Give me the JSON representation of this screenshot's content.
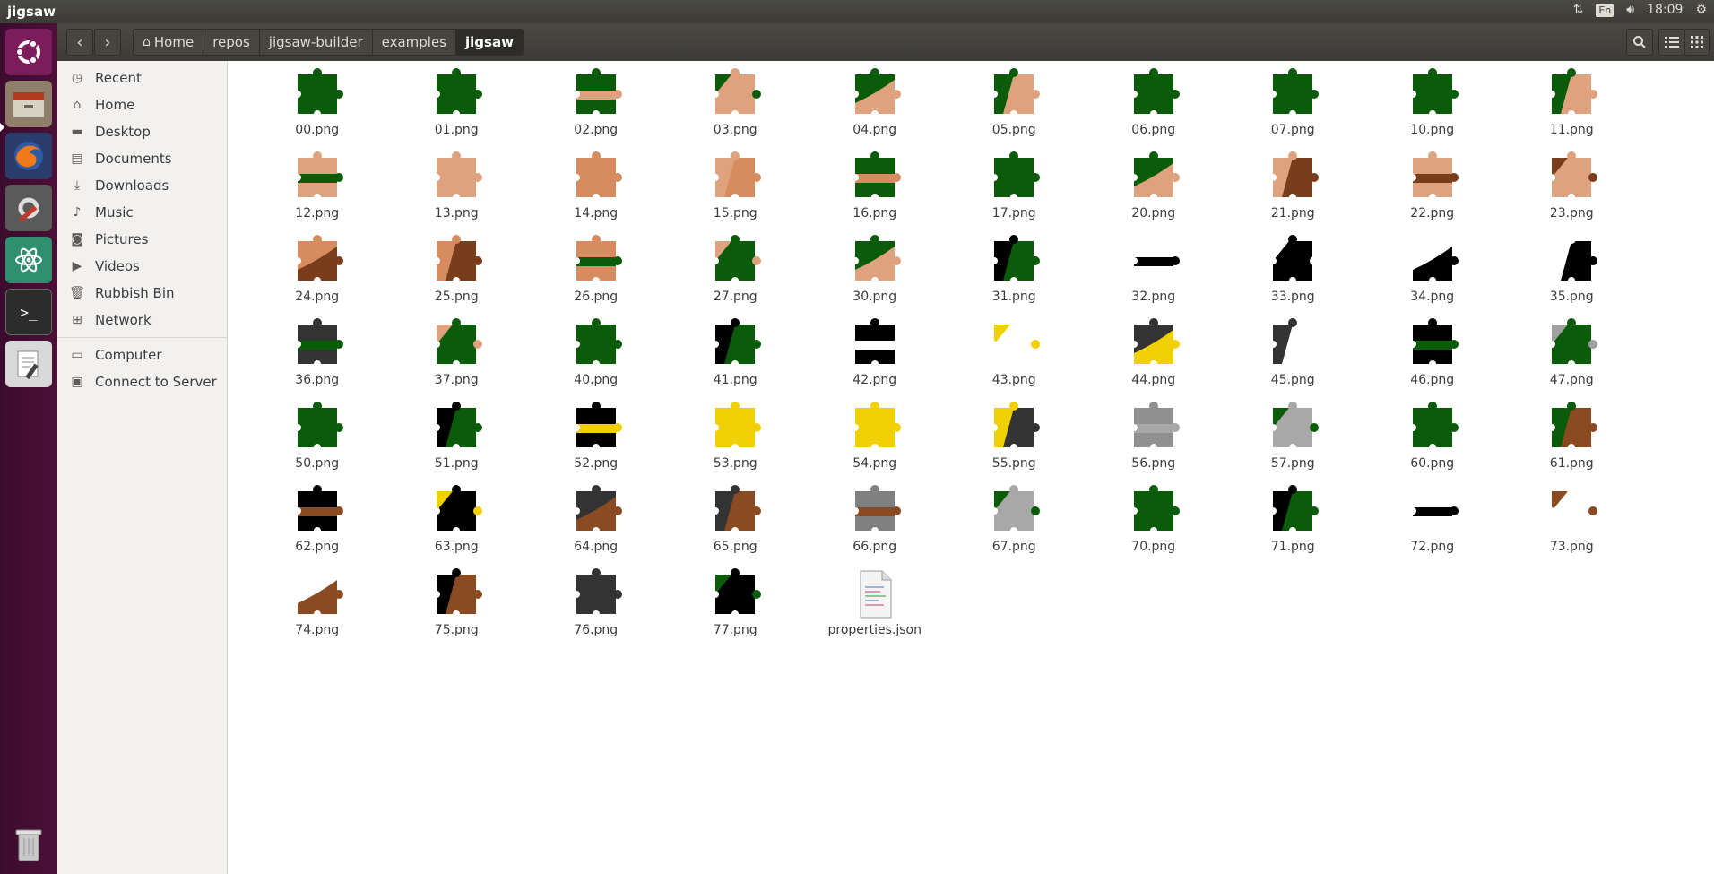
{
  "window": {
    "title": "jigsaw"
  },
  "topbar": {
    "clock": "18:09",
    "lang": "En",
    "icons": [
      "network-arrows-icon",
      "keyboard-lang-icon",
      "volume-icon",
      "gear-icon"
    ]
  },
  "launcher": {
    "items": [
      "ubuntu-dash-icon",
      "files-icon",
      "firefox-icon",
      "system-settings-icon",
      "atom-icon",
      "terminal-icon",
      "text-editor-icon",
      "trash-icon"
    ]
  },
  "header": {
    "crumbs": [
      "Home",
      "repos",
      "jigsaw-builder",
      "examples",
      "jigsaw"
    ]
  },
  "sidebar": {
    "places": [
      "Recent",
      "Home",
      "Desktop",
      "Documents",
      "Downloads",
      "Music",
      "Pictures",
      "Videos",
      "Rubbish Bin",
      "Network"
    ],
    "other": [
      "Computer",
      "Connect to Server"
    ]
  },
  "files": [
    {
      "name": "00.png",
      "c1": "#0a5c0a",
      "c2": "#0a5c0a"
    },
    {
      "name": "01.png",
      "c1": "#0a5c0a",
      "c2": "#0a5c0a"
    },
    {
      "name": "02.png",
      "c1": "#0a5c0a",
      "c2": "#dea27e"
    },
    {
      "name": "03.png",
      "c1": "#dea27e",
      "c2": "#0a5c0a"
    },
    {
      "name": "04.png",
      "c1": "#0a5c0a",
      "c2": "#dea27e"
    },
    {
      "name": "05.png",
      "c1": "#0a5c0a",
      "c2": "#dea27e"
    },
    {
      "name": "06.png",
      "c1": "#0a5c0a",
      "c2": "#0a5c0a"
    },
    {
      "name": "07.png",
      "c1": "#0a5c0a",
      "c2": "#0a5c0a"
    },
    {
      "name": "10.png",
      "c1": "#0a5c0a",
      "c2": "#0a5c0a"
    },
    {
      "name": "11.png",
      "c1": "#0a5c0a",
      "c2": "#dea27e"
    },
    {
      "name": "12.png",
      "c1": "#dea27e",
      "c2": "#0a5c0a"
    },
    {
      "name": "13.png",
      "c1": "#dea27e",
      "c2": "#dea27e"
    },
    {
      "name": "14.png",
      "c1": "#d68c5e",
      "c2": "#d68c5e"
    },
    {
      "name": "15.png",
      "c1": "#dea27e",
      "c2": "#d68c5e"
    },
    {
      "name": "16.png",
      "c1": "#0a5c0a",
      "c2": "#d68c5e"
    },
    {
      "name": "17.png",
      "c1": "#0a5c0a",
      "c2": "#0a5c0a"
    },
    {
      "name": "20.png",
      "c1": "#0a5c0a",
      "c2": "#dea27e"
    },
    {
      "name": "21.png",
      "c1": "#dea27e",
      "c2": "#7a3d1c"
    },
    {
      "name": "22.png",
      "c1": "#dea27e",
      "c2": "#7a3d1c"
    },
    {
      "name": "23.png",
      "c1": "#dea27e",
      "c2": "#7a3d1c"
    },
    {
      "name": "24.png",
      "c1": "#d68c5e",
      "c2": "#7a3d1c"
    },
    {
      "name": "25.png",
      "c1": "#d68c5e",
      "c2": "#7a3d1c"
    },
    {
      "name": "26.png",
      "c1": "#d68c5e",
      "c2": "#0a5c0a"
    },
    {
      "name": "27.png",
      "c1": "#0a5c0a",
      "c2": "#dea27e"
    },
    {
      "name": "30.png",
      "c1": "#0a5c0a",
      "c2": "#dea27e"
    },
    {
      "name": "31.png",
      "c1": "#000000",
      "c2": "#0a5c0a"
    },
    {
      "name": "32.png",
      "c1": "#ffffff",
      "c2": "#000000"
    },
    {
      "name": "33.png",
      "c1": "#000000",
      "c2": "#ffffff"
    },
    {
      "name": "34.png",
      "c1": "#ffffff",
      "c2": "#000000"
    },
    {
      "name": "35.png",
      "c1": "#ffffff",
      "c2": "#000000"
    },
    {
      "name": "36.png",
      "c1": "#333333",
      "c2": "#0a5c0a"
    },
    {
      "name": "37.png",
      "c1": "#0a5c0a",
      "c2": "#dea27e"
    },
    {
      "name": "40.png",
      "c1": "#0a5c0a",
      "c2": "#0a5c0a"
    },
    {
      "name": "41.png",
      "c1": "#000000",
      "c2": "#0a5c0a"
    },
    {
      "name": "42.png",
      "c1": "#000000",
      "c2": "#ffffff"
    },
    {
      "name": "43.png",
      "c1": "#ffffff",
      "c2": "#f0d000"
    },
    {
      "name": "44.png",
      "c1": "#333333",
      "c2": "#f0d000"
    },
    {
      "name": "45.png",
      "c1": "#333333",
      "c2": "#ffffff"
    },
    {
      "name": "46.png",
      "c1": "#000000",
      "c2": "#0a5c0a"
    },
    {
      "name": "47.png",
      "c1": "#0a5c0a",
      "c2": "#a0a0a0"
    },
    {
      "name": "50.png",
      "c1": "#0a5c0a",
      "c2": "#0a5c0a"
    },
    {
      "name": "51.png",
      "c1": "#000000",
      "c2": "#0a5c0a"
    },
    {
      "name": "52.png",
      "c1": "#000000",
      "c2": "#f0d000"
    },
    {
      "name": "53.png",
      "c1": "#f0d000",
      "c2": "#f0d000"
    },
    {
      "name": "54.png",
      "c1": "#f0d000",
      "c2": "#f0d000"
    },
    {
      "name": "55.png",
      "c1": "#f0d000",
      "c2": "#333333"
    },
    {
      "name": "56.png",
      "c1": "#909090",
      "c2": "#a8a8a8"
    },
    {
      "name": "57.png",
      "c1": "#a8a8a8",
      "c2": "#0a5c0a"
    },
    {
      "name": "60.png",
      "c1": "#0a5c0a",
      "c2": "#0a5c0a"
    },
    {
      "name": "61.png",
      "c1": "#0a5c0a",
      "c2": "#8a4a22"
    },
    {
      "name": "62.png",
      "c1": "#000000",
      "c2": "#8a4a22"
    },
    {
      "name": "63.png",
      "c1": "#000000",
      "c2": "#f0d000"
    },
    {
      "name": "64.png",
      "c1": "#333333",
      "c2": "#8a4a22"
    },
    {
      "name": "65.png",
      "c1": "#333333",
      "c2": "#8a4a22"
    },
    {
      "name": "66.png",
      "c1": "#808080",
      "c2": "#8a4a22"
    },
    {
      "name": "67.png",
      "c1": "#a8a8a8",
      "c2": "#0a5c0a"
    },
    {
      "name": "70.png",
      "c1": "#0a5c0a",
      "c2": "#0a5c0a"
    },
    {
      "name": "71.png",
      "c1": "#000000",
      "c2": "#0a5c0a"
    },
    {
      "name": "72.png",
      "c1": "#ffffff",
      "c2": "#000000"
    },
    {
      "name": "73.png",
      "c1": "#ffffff",
      "c2": "#8a4a22"
    },
    {
      "name": "74.png",
      "c1": "#ffffff",
      "c2": "#8a4a22"
    },
    {
      "name": "75.png",
      "c1": "#000000",
      "c2": "#8a4a22"
    },
    {
      "name": "76.png",
      "c1": "#333333",
      "c2": "#333333"
    },
    {
      "name": "77.png",
      "c1": "#000000",
      "c2": "#0a5c0a"
    },
    {
      "name": "properties.json",
      "c1": "",
      "c2": "",
      "doc": true
    }
  ]
}
